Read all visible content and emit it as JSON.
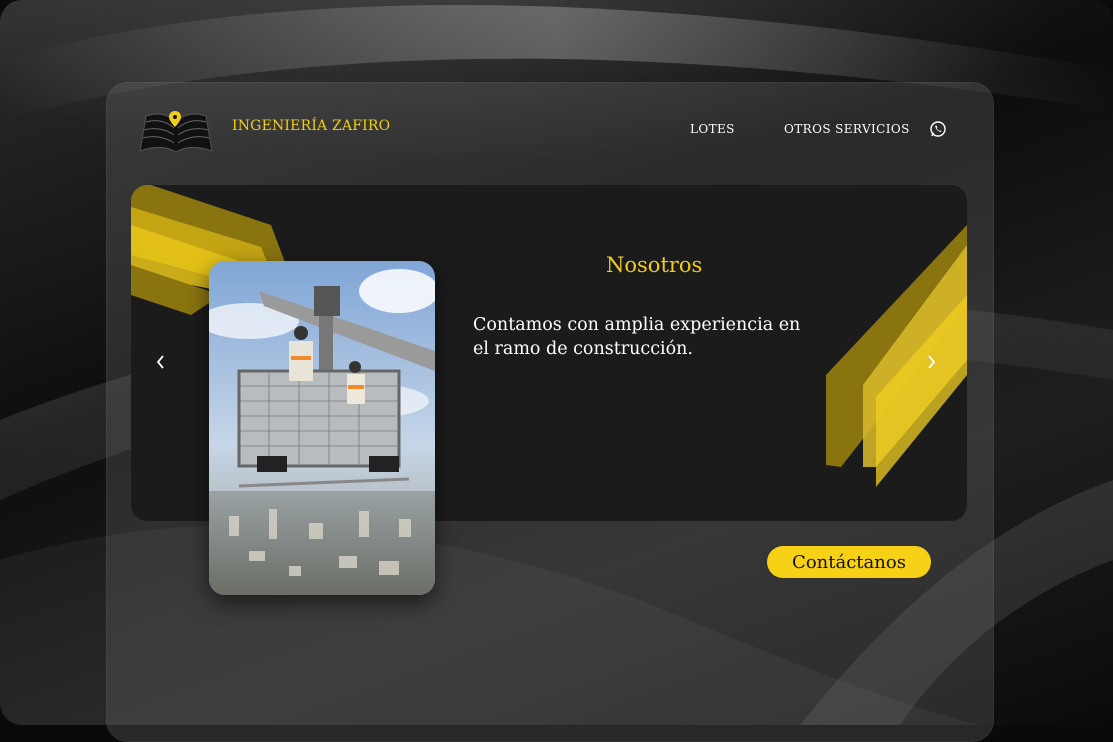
{
  "header": {
    "brand": "INGENIERÍA ZAFIRO",
    "nav": [
      {
        "label": "LOTES"
      },
      {
        "label": "OTROS SERVICIOS"
      }
    ],
    "whatsapp_icon": "whatsapp-icon",
    "logo_icon": "open-book-with-location-pin-logo"
  },
  "hero": {
    "heading": "Nosotros",
    "description": "Contamos con amplia experiencia en el ramo de construcción.",
    "photo_alt": "Workers on a suspended platform above a city",
    "prev_icon": "chevron-left-icon",
    "next_icon": "chevron-right-icon"
  },
  "cta": {
    "label": "Contáctanos"
  },
  "colors": {
    "accent": "#f2cc16",
    "card": "#1b1b1c",
    "cta_bg": "#f7d116"
  }
}
